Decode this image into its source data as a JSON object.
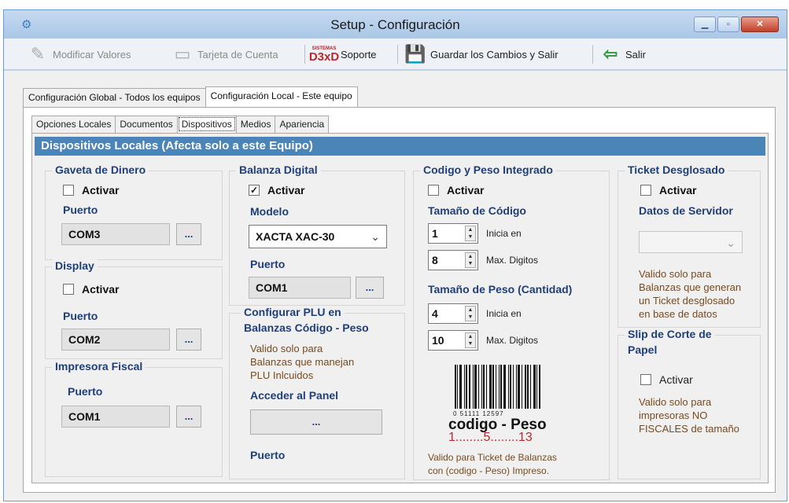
{
  "window": {
    "title": "Setup - Configuración"
  },
  "toolbar": {
    "modify_label": "Modificar Valores",
    "account_label": "Tarjeta de Cuenta",
    "support_logo_top": "SISTEMAS",
    "support_logo_main": "D3xD",
    "support_label": "Soporte",
    "save_label": "Guardar los Cambios  y Salir",
    "exit_label": "Salir"
  },
  "top_tabs": [
    "Configuración Global - Todos los equipos",
    "Configuración Local - Este equipo"
  ],
  "sub_tabs": [
    "Opciones Locales",
    "Documentos",
    "Dispositivos",
    "Medios",
    "Apariencia"
  ],
  "header": "Dispositivos Locales (Afecta solo a este Equipo)",
  "gaveta": {
    "title": "Gaveta de Dinero",
    "activar": "Activar",
    "puerto_label": "Puerto",
    "puerto": "COM3",
    "dots": "..."
  },
  "display": {
    "title": "Display",
    "activar": "Activar",
    "puerto_label": "Puerto",
    "puerto": "COM2",
    "dots": "..."
  },
  "impresora": {
    "title": "Impresora Fiscal",
    "puerto_label": "Puerto",
    "puerto": "COM1",
    "dots": "..."
  },
  "balanza": {
    "title": "Balanza Digital",
    "activar": "Activar",
    "modelo_label": "Modelo",
    "modelo": "XACTA XAC-30",
    "puerto_label": "Puerto",
    "puerto": "COM1",
    "dots": "..."
  },
  "plu": {
    "title_line1": "Configurar PLU en",
    "title_line2": "Balanzas Código - Peso",
    "note_line1": "Valido solo para",
    "note_line2": "Balanzas que manejan",
    "note_line3": "PLU Inlcuidos",
    "panel_label": "Acceder al Panel",
    "panel_button": "...",
    "puerto_label": "Puerto"
  },
  "codigo": {
    "title": "Codigo y Peso Integrado",
    "activar": "Activar",
    "tam_codigo": "Tamaño de Código",
    "codigo_inicia": "1",
    "codigo_inicia_label": "Inicia en",
    "codigo_max": "8",
    "codigo_max_label": "Max. Digitos",
    "tam_peso": "Tamaño de Peso (Cantidad)",
    "peso_inicia": "4",
    "peso_inicia_label": "Inicia en",
    "peso_max": "10",
    "peso_max_label": "Max. Digitos",
    "barcode_digits": "0  51111    12597",
    "barcode_caption": "codigo  - Peso",
    "barcode_positions": "1........5........13",
    "note_line1": "Valido para Ticket de Balanzas",
    "note_line2": "con (codigo - Peso) Impreso."
  },
  "ticket": {
    "title": "Ticket Desglosado",
    "activar": "Activar",
    "servidor_label": "Datos de Servidor",
    "note_line1": "Valido solo para",
    "note_line2": "Balanzas que generan",
    "note_line3": "un Ticket desglosado",
    "note_line4": "en base de datos"
  },
  "slip": {
    "title_line1": "Slip de Corte de",
    "title_line2": "Papel",
    "activar": "Activar",
    "note_line1": "Valido solo para",
    "note_line2": "impresoras NO",
    "note_line3": "FISCALES de tamaño"
  }
}
